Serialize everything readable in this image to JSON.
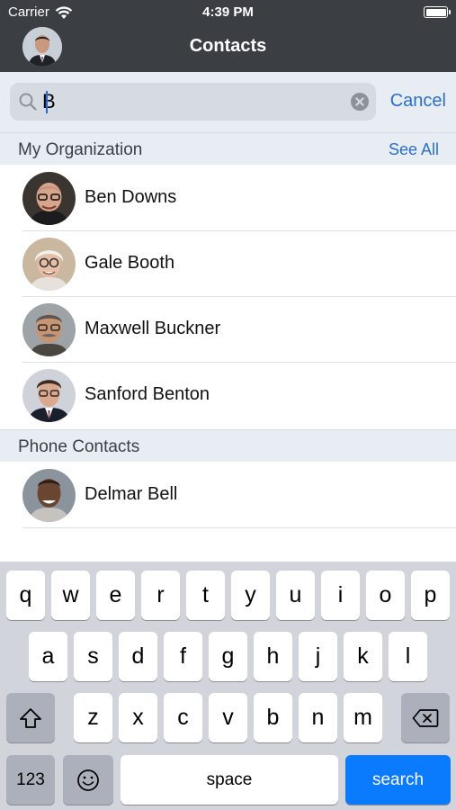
{
  "status": {
    "carrier": "Carrier",
    "time": "4:39 PM"
  },
  "nav": {
    "title": "Contacts"
  },
  "search": {
    "value": "B",
    "cancel_label": "Cancel"
  },
  "sections": [
    {
      "title": "My Organization",
      "action_label": "See All",
      "contacts": [
        {
          "name": "Ben Downs",
          "avatar": "photo-bald-glasses"
        },
        {
          "name": "Gale Booth",
          "avatar": "photo-gray-hair-glasses"
        },
        {
          "name": "Maxwell Buckner",
          "avatar": "photo-mustache-glasses"
        },
        {
          "name": "Sanford Benton",
          "avatar": "photo-glasses-suit"
        }
      ]
    },
    {
      "title": "Phone Contacts",
      "contacts": [
        {
          "name": "Delmar Bell",
          "avatar": "photo-smiling-man"
        }
      ]
    }
  ],
  "keyboard": {
    "row1": [
      "q",
      "w",
      "e",
      "r",
      "t",
      "y",
      "u",
      "i",
      "o",
      "p"
    ],
    "row2": [
      "a",
      "s",
      "d",
      "f",
      "g",
      "h",
      "j",
      "k",
      "l"
    ],
    "row3": [
      "z",
      "x",
      "c",
      "v",
      "b",
      "n",
      "m"
    ],
    "shift_icon": "shift-icon",
    "delete_icon": "backspace-icon",
    "numbers_label": "123",
    "emoji_icon": "emoji-icon",
    "space_label": "space",
    "search_label": "search"
  },
  "colors": {
    "nav_bg": "#3b3f44",
    "accent": "#2a6fc9",
    "search_key": "#0a7aff"
  }
}
